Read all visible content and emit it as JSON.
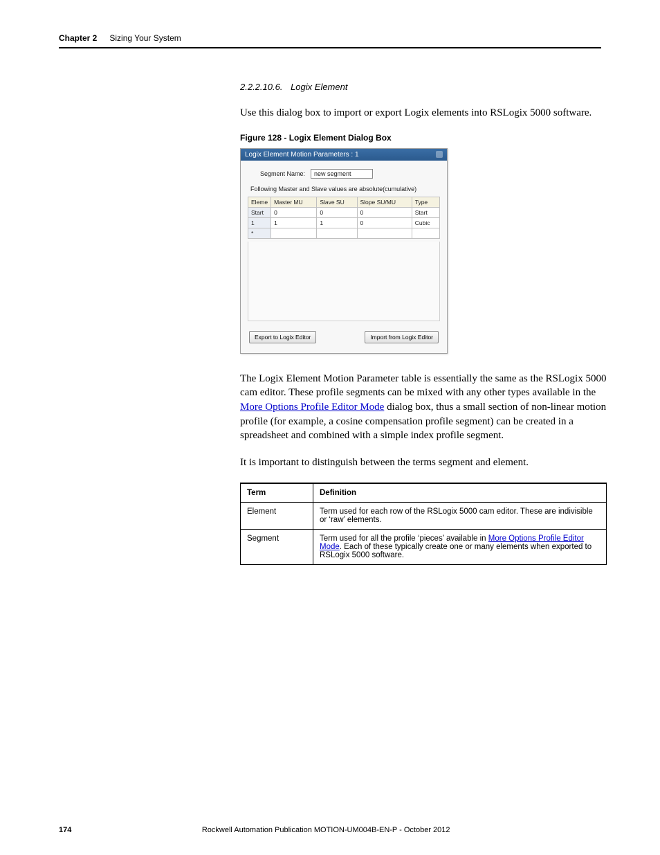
{
  "header": {
    "chapter": "Chapter 2",
    "title": "Sizing Your System"
  },
  "section": {
    "number": "2.2.2.10.6.",
    "name": "Logix Element",
    "intro": "Use this dialog box to import or export Logix elements into RSLogix 5000 software.",
    "figure_caption": "Figure 128 - Logix Element Dialog Box"
  },
  "dialog": {
    "title": "Logix Element Motion Parameters : 1",
    "segment_label": "Segment Name:",
    "segment_value": "new segment",
    "note": "Following Master and Slave values are absolute(cumulative)",
    "columns": [
      "Eleme",
      "Master   MU",
      "Slave   SU",
      "Slope   SU/MU",
      "Type"
    ],
    "rows": [
      {
        "head": "Start",
        "cells": [
          "0",
          "0",
          "0",
          "Start"
        ]
      },
      {
        "head": "1",
        "cells": [
          "1",
          "1",
          "0",
          "Cubic"
        ]
      },
      {
        "head": "*",
        "cells": [
          "",
          "",
          "",
          ""
        ]
      }
    ],
    "btn_export": "Export to Logix Editor",
    "btn_import": "Import from Logix Editor"
  },
  "body": {
    "p1_a": "The Logix Element Motion Parameter table is essentially the same as the RSLogix 5000 cam editor. These profile segments can be mixed with any other types available in the ",
    "p1_link": "More Options Profile Editor Mode",
    "p1_b": " dialog box, thus a small section of non-linear motion profile (for example, a cosine compensation profile segment) can be created in a spreadsheet and combined with a simple index profile segment.",
    "p2": "It is important to distinguish between the terms segment and element."
  },
  "table": {
    "h1": "Term",
    "h2": "Definition",
    "r1c1": "Element",
    "r1c2": "Term used for each row of the RSLogix 5000 cam editor. These are indivisible or ‘raw’ elements.",
    "r2c1": "Segment",
    "r2c2a": "Term used for all the profile ‘pieces’ available in ",
    "r2link": "More Options Profile Editor Mode",
    "r2c2b": ". Each of these typically create one or many elements when exported to RSLogix 5000 software."
  },
  "footer": {
    "page": "174",
    "pub": "Rockwell Automation Publication MOTION-UM004B-EN-P - October 2012"
  }
}
